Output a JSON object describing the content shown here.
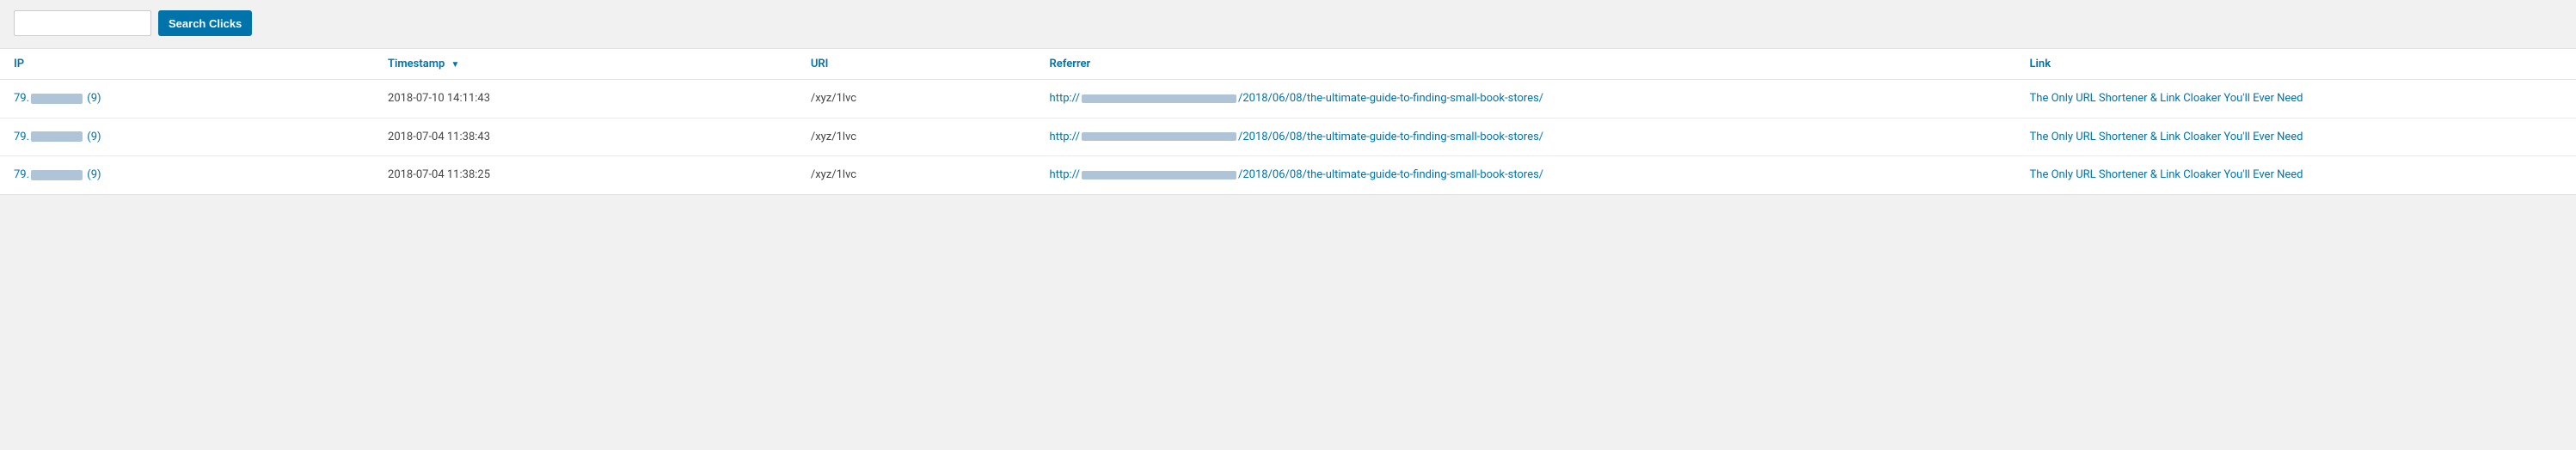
{
  "topbar": {
    "search_placeholder": "",
    "search_button_label": "Search Clicks"
  },
  "table": {
    "columns": [
      {
        "key": "ip",
        "label": "IP",
        "sortable": false
      },
      {
        "key": "timestamp",
        "label": "Timestamp",
        "sortable": true,
        "sorted": true
      },
      {
        "key": "uri",
        "label": "URI",
        "sortable": false
      },
      {
        "key": "referrer",
        "label": "Referrer",
        "sortable": false
      },
      {
        "key": "link",
        "label": "Link",
        "sortable": false
      }
    ],
    "rows": [
      {
        "ip_prefix": "79.",
        "ip_suffix": " (9)",
        "timestamp": "2018-07-10 14:11:43",
        "uri": "/xyz/1lvc",
        "referrer_prefix": "http://",
        "referrer_suffix": "/2018/06/08/the-ultimate-guide-to-finding-small-book-stores/",
        "link": "The Only URL Shortener & Link Cloaker You'll Ever Need"
      },
      {
        "ip_prefix": "79.",
        "ip_suffix": " (9)",
        "timestamp": "2018-07-04 11:38:43",
        "uri": "/xyz/1lvc",
        "referrer_prefix": "http://",
        "referrer_suffix": "/2018/06/08/the-ultimate-guide-to-finding-small-book-stores/",
        "link": "The Only URL Shortener & Link Cloaker You'll Ever Need"
      },
      {
        "ip_prefix": "79.",
        "ip_suffix": " (9)",
        "timestamp": "2018-07-04 11:38:25",
        "uri": "/xyz/1lvc",
        "referrer_prefix": "http://",
        "referrer_suffix": "/2018/06/08/the-ultimate-guide-to-finding-small-book-stores/",
        "link": "The Only URL Shortener & Link Cloaker You'll Ever Need"
      }
    ]
  }
}
